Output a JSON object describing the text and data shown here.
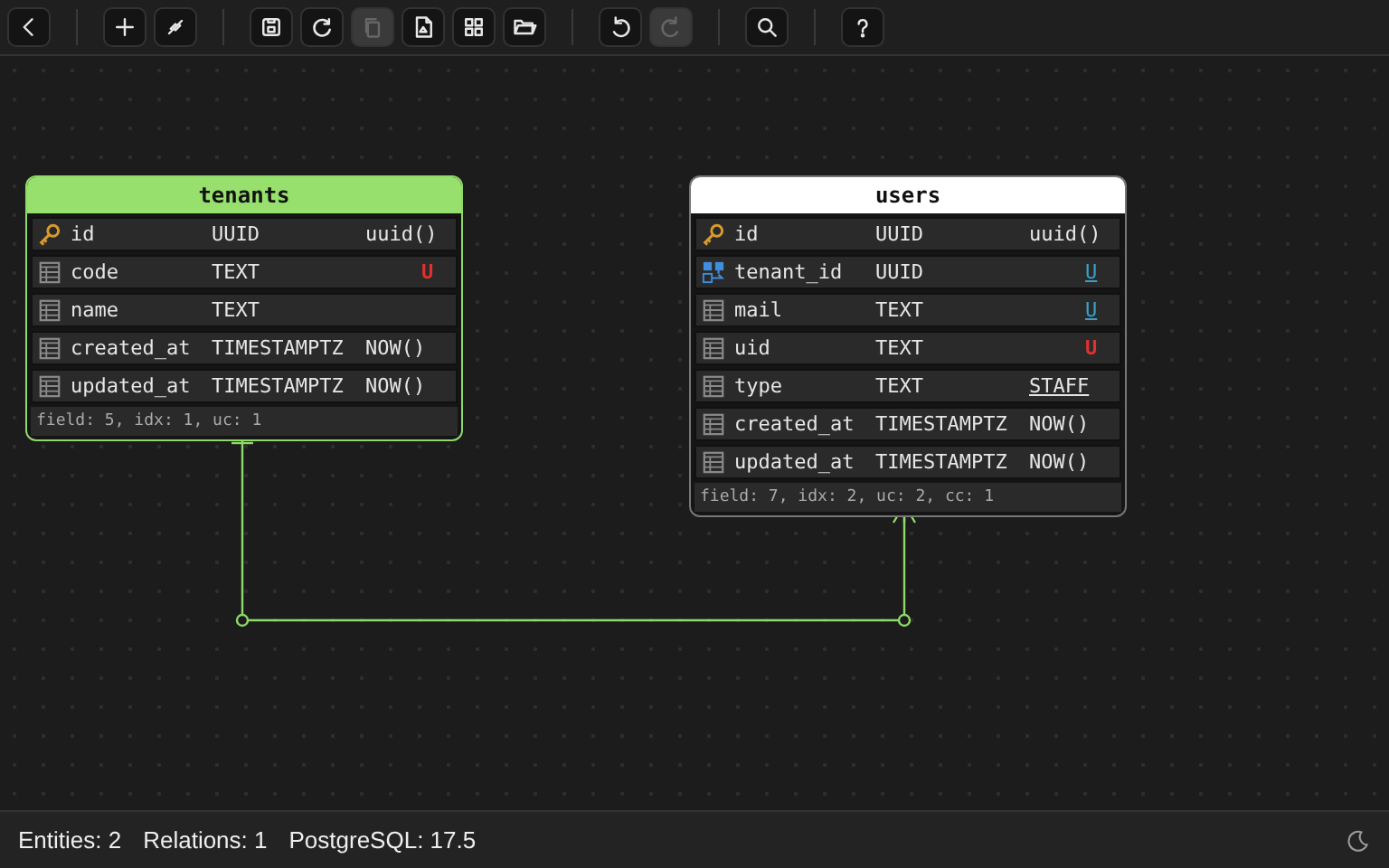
{
  "toolbar": {
    "groups": [
      [
        {
          "kind": "back",
          "disabled": false
        }
      ],
      [
        {
          "kind": "add",
          "disabled": false
        },
        {
          "kind": "link",
          "disabled": false
        }
      ],
      [
        {
          "kind": "save",
          "disabled": false
        },
        {
          "kind": "refresh",
          "disabled": false
        },
        {
          "kind": "copy",
          "disabled": true
        },
        {
          "kind": "export",
          "disabled": false
        },
        {
          "kind": "grid",
          "disabled": false
        },
        {
          "kind": "open",
          "disabled": false
        }
      ],
      [
        {
          "kind": "undo",
          "disabled": false
        },
        {
          "kind": "redo",
          "disabled": true
        }
      ],
      [
        {
          "kind": "search",
          "disabled": false
        }
      ],
      [
        {
          "kind": "help",
          "disabled": false
        }
      ]
    ]
  },
  "entities": [
    {
      "name": "tenants",
      "selected": true,
      "fields": [
        {
          "kind": "primary_key",
          "name": "id",
          "type": "UUID",
          "default": {
            "text": "uuid()",
            "underlined": false
          }
        },
        {
          "kind": "column",
          "name": "code",
          "type": "TEXT",
          "flag": {
            "text": "U",
            "kind": "unique"
          }
        },
        {
          "kind": "column",
          "name": "name",
          "type": "TEXT"
        },
        {
          "kind": "column",
          "name": "created_at",
          "type": "TIMESTAMPTZ",
          "default": {
            "text": "NOW()",
            "underlined": false
          }
        },
        {
          "kind": "column",
          "name": "updated_at",
          "type": "TIMESTAMPTZ",
          "default": {
            "text": "NOW()",
            "underlined": false
          }
        }
      ],
      "summary": "field: 5, idx: 1, uc: 1"
    },
    {
      "name": "users",
      "selected": false,
      "fields": [
        {
          "kind": "primary_key",
          "name": "id",
          "type": "UUID",
          "default": {
            "text": "uuid()",
            "underlined": false
          }
        },
        {
          "kind": "foreign_key",
          "name": "tenant_id",
          "type": "UUID",
          "flag": {
            "text": "U",
            "kind": "index"
          }
        },
        {
          "kind": "column",
          "name": "mail",
          "type": "TEXT",
          "flag": {
            "text": "U",
            "kind": "index"
          }
        },
        {
          "kind": "column",
          "name": "uid",
          "type": "TEXT",
          "flag": {
            "text": "U",
            "kind": "unique"
          }
        },
        {
          "kind": "column",
          "name": "type",
          "type": "TEXT",
          "default": {
            "text": "STAFF",
            "underlined": true
          }
        },
        {
          "kind": "column",
          "name": "created_at",
          "type": "TIMESTAMPTZ",
          "default": {
            "text": "NOW()",
            "underlined": false
          }
        },
        {
          "kind": "column",
          "name": "updated_at",
          "type": "TIMESTAMPTZ",
          "default": {
            "text": "NOW()",
            "underlined": false
          }
        }
      ],
      "summary": "field: 7, idx: 2, uc: 2, cc: 1"
    }
  ],
  "status_bar": {
    "items": [
      "Entities: 2",
      "Relations: 1",
      "PostgreSQL: 17.5"
    ]
  }
}
